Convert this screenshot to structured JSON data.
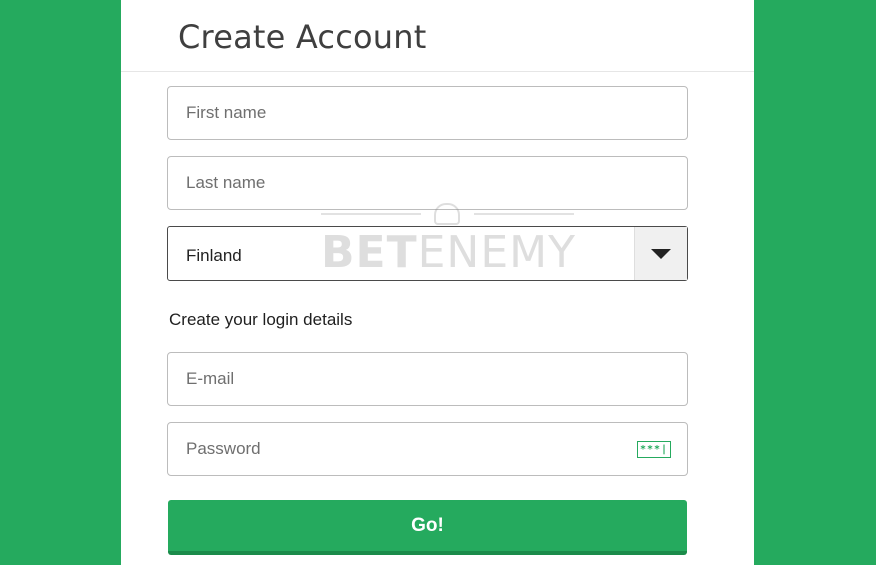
{
  "modal": {
    "title": "Create Account"
  },
  "form": {
    "first_name_placeholder": "First name",
    "last_name_placeholder": "Last name",
    "country_value": "Finland",
    "section_label": "Create your login details",
    "email_placeholder": "E-mail",
    "password_placeholder": "Password",
    "password_icon_text": "***|",
    "submit_label": "Go!"
  },
  "watermark": {
    "bold_part": "BET",
    "light_part": "ENEMY"
  },
  "colors": {
    "background": "#25aa5e",
    "accent": "#25aa5e",
    "button": "#25aa5e"
  }
}
